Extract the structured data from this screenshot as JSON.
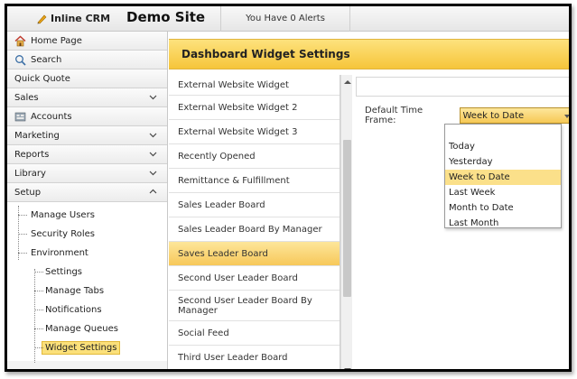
{
  "header": {
    "app_name": "Inline CRM",
    "site_name": "Demo Site",
    "alerts": "You Have 0 Alerts"
  },
  "nav": {
    "items": [
      {
        "label": "Home Page",
        "icon": "home-icon"
      },
      {
        "label": "Search",
        "icon": "search-icon"
      },
      {
        "label": "Quick Quote"
      },
      {
        "label": "Sales",
        "chevron": "down"
      },
      {
        "label": "Accounts",
        "icon": "accounts-icon"
      },
      {
        "label": "Marketing",
        "chevron": "down"
      },
      {
        "label": "Reports",
        "chevron": "down"
      },
      {
        "label": "Library",
        "chevron": "down"
      },
      {
        "label": "Setup",
        "chevron": "up"
      }
    ],
    "tree": {
      "manage_users": "Manage Users",
      "security_roles": "Security Roles",
      "environment": "Environment",
      "settings": "Settings",
      "manage_tabs": "Manage Tabs",
      "notifications": "Notifications",
      "manage_queues": "Manage Queues",
      "widget_settings": "Widget Settings"
    }
  },
  "content": {
    "title": "Dashboard Widget Settings"
  },
  "widgets": [
    {
      "label": "External Website Widget",
      "h": 23
    },
    {
      "label": "External Website Widget 2",
      "h": 27
    },
    {
      "label": "External Website Widget 3",
      "h": 27
    },
    {
      "label": "Recently Opened",
      "h": 27
    },
    {
      "label": "Remittance & Fulfillment",
      "h": 27
    },
    {
      "label": "Sales Leader Board",
      "h": 27
    },
    {
      "label": "Sales Leader Board By Manager",
      "h": 27
    },
    {
      "label": "Saves Leader Board",
      "h": 27,
      "selected": true
    },
    {
      "label": "Second User Leader Board",
      "h": 27
    },
    {
      "label": "Second User Leader Board By Manager",
      "h": 34
    },
    {
      "label": "Social Feed",
      "h": 27
    },
    {
      "label": "Third User Leader Board",
      "h": 27
    }
  ],
  "settings": {
    "time_frame_label": "Default Time Frame:",
    "time_frame_value": "Week to Date",
    "options": [
      "Today",
      "Yesterday",
      "Week to Date",
      "Last Week",
      "Month to Date",
      "Last Month"
    ],
    "selected_option": "Week to Date"
  },
  "colors": {
    "accent": "#f6c53a",
    "highlight": "#fbe08a"
  }
}
